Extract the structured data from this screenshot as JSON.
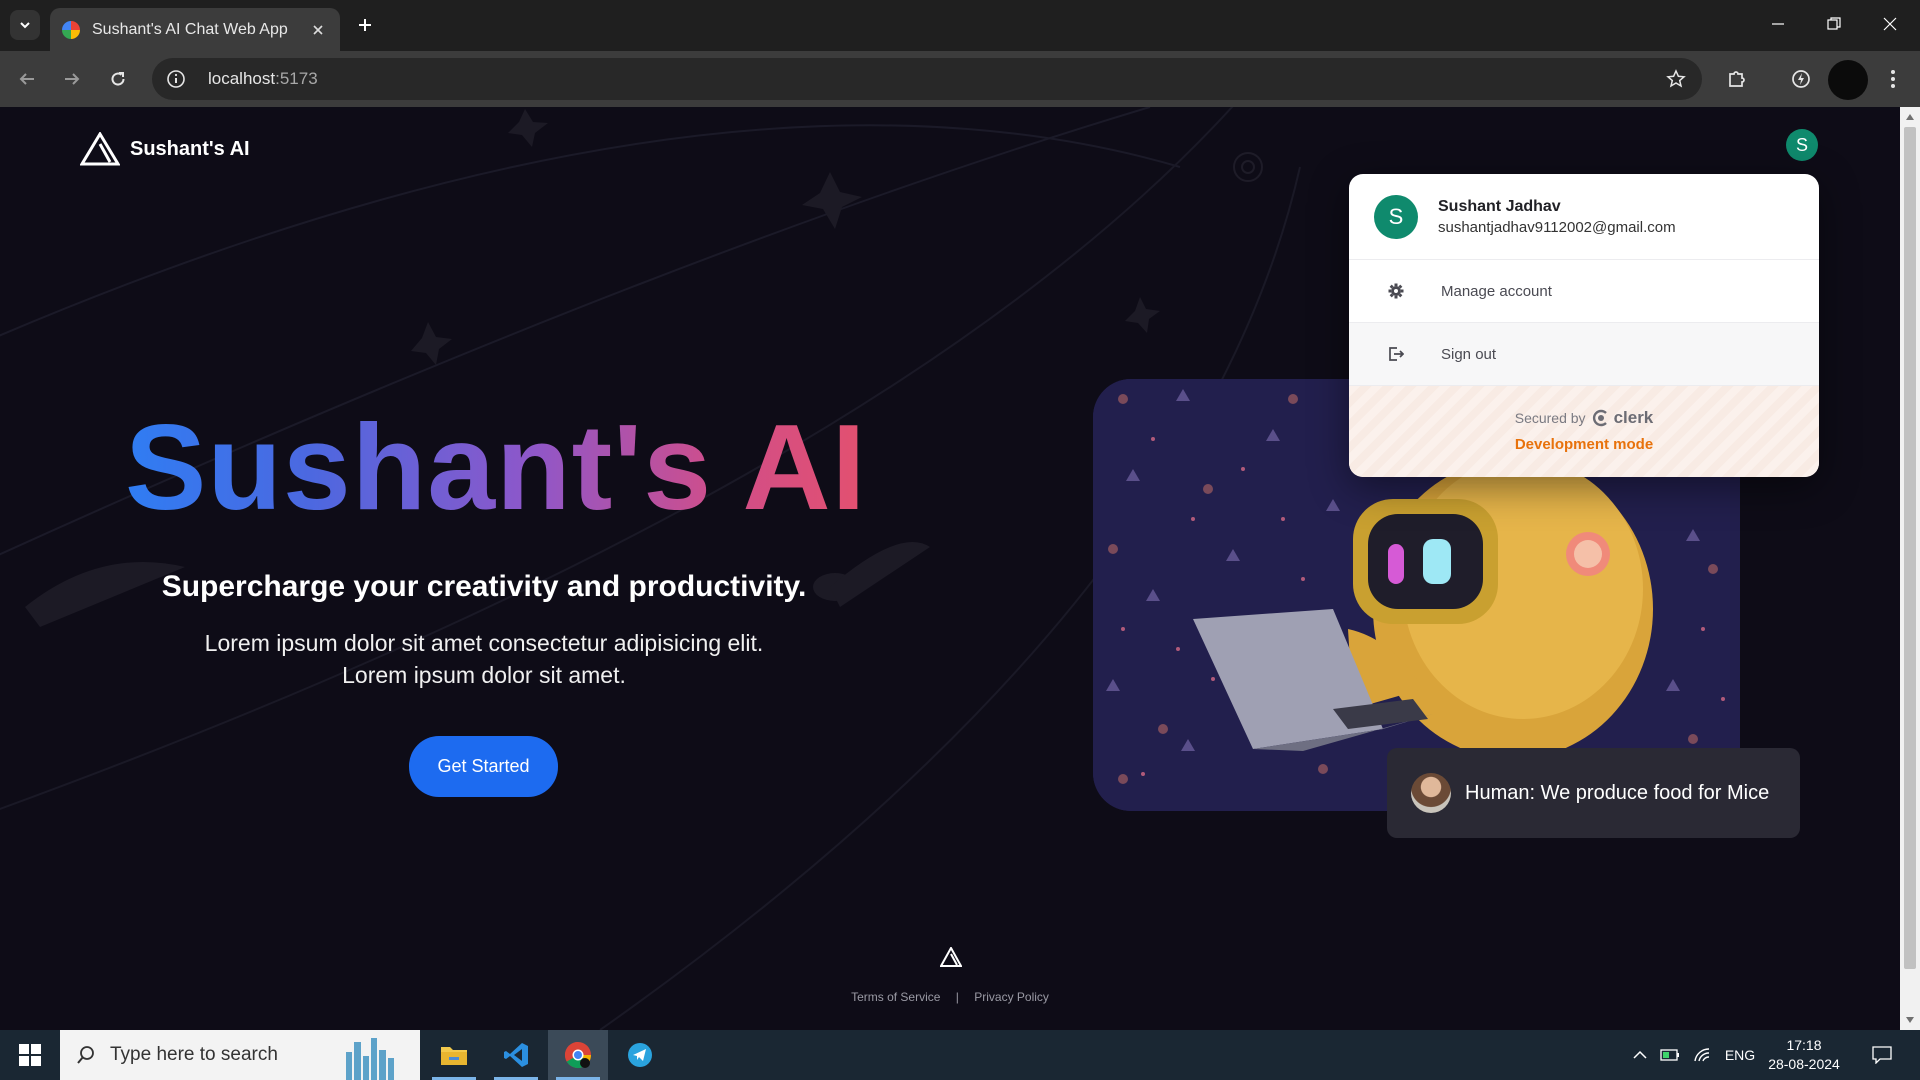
{
  "browser": {
    "tab_title": "Sushant's AI Chat Web App",
    "url_host": "localhost",
    "url_port": ":5173"
  },
  "header": {
    "logo_text": "Sushant's AI",
    "avatar_initial": "S"
  },
  "hero": {
    "title": "Sushant's AI",
    "subtitle": "Supercharge your creativity and productivity.",
    "description_line1": "Lorem ipsum dolor sit amet consectetur adipisicing elit.",
    "description_line2": "Lorem ipsum dolor sit amet.",
    "cta_label": "Get Started"
  },
  "chat_preview": {
    "message": "Human: We produce food for Mice"
  },
  "footer": {
    "terms": "Terms of Service",
    "separator": "|",
    "privacy": "Privacy Policy"
  },
  "account_menu": {
    "avatar_initial": "S",
    "name": "Sushant Jadhav",
    "email": "sushantjadhav9112002@gmail.com",
    "manage_label": "Manage account",
    "signout_label": "Sign out",
    "secured_by": "Secured by",
    "provider": "clerk",
    "dev_mode": "Development mode"
  },
  "taskbar": {
    "search_placeholder": "Type here to search",
    "language": "ENG",
    "time": "17:18",
    "date": "28-08-2024"
  },
  "colors": {
    "accent_blue": "#1d6bf0",
    "avatar_green": "#0f8a6d",
    "dev_orange": "#e8720c",
    "page_bg": "#0e0c17"
  }
}
